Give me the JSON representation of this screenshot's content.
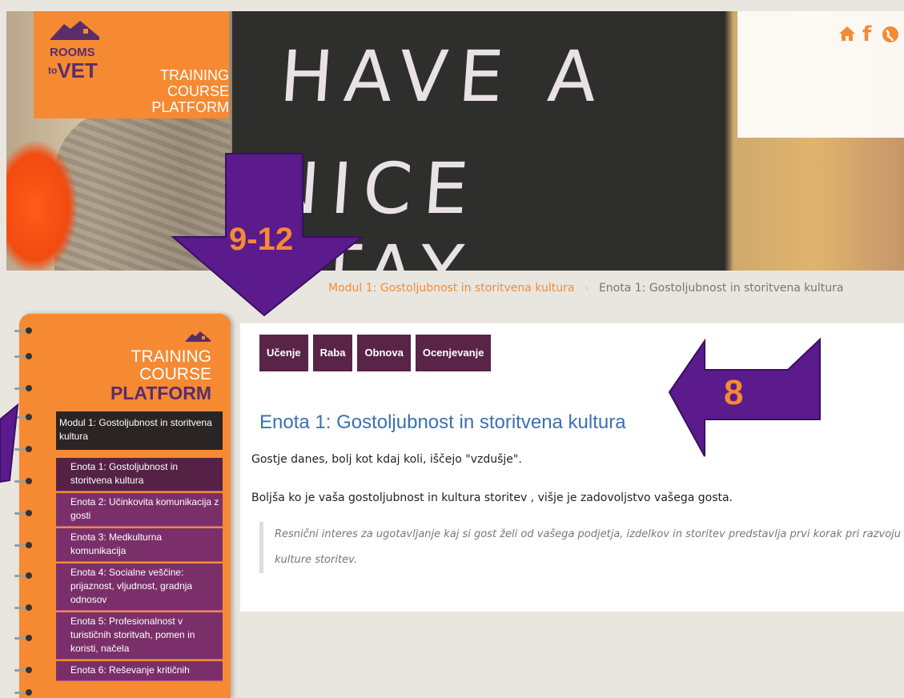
{
  "header": {
    "logo_rooms": "ROOMS",
    "logo_to": "to",
    "logo_vet": "VET",
    "logo_line1": "TRAINING COURSE",
    "logo_line2": "PLATFORM",
    "chalk_line1": "HAVE A",
    "chalk_line2": "NICE STAY",
    "icons": [
      "home-icon",
      "facebook-icon",
      "globe-icon"
    ],
    "icon_glyphs": {
      "home": "🏠",
      "facebook": "f",
      "globe": "◉"
    }
  },
  "breadcrumb": {
    "items": [
      "Modul 1: Gostoljubnost in storitvena kultura",
      "Enota 1: Gostoljubnost in storitvena kultura"
    ]
  },
  "sidebar": {
    "title1": "TRAINING COURSE",
    "title2": "PLATFORM",
    "module": "Modul 1: Gostoljubnost in storitvena kultura",
    "items": [
      {
        "label": "Enota 1: Gostoljubnost in storitvena kultura",
        "selected": true
      },
      {
        "label": "Enota 2: Učinkovita komunikacija z gosti"
      },
      {
        "label": "Enota 3: Medkulturna komunikacija"
      },
      {
        "label": "Enota 4: Socialne veščine: prijaznost, vljudnost, gradnja odnosov"
      },
      {
        "label": "Enota 5: Profesionalnost v turističnih storitvah, pomen in koristi, načela"
      },
      {
        "label": "Enota 6: Reševanje kritičnih"
      }
    ]
  },
  "main": {
    "tabs": [
      "Učenje",
      "Raba",
      "Obnova",
      "Ocenjevanje"
    ],
    "title": "Enota 1: Gostoljubnost in storitvena kultura",
    "para1": "Gostje danes, bolj kot kdaj koli, iščejo \"vzdušje\".",
    "para2": "Boljša ko je vaša gostoljubnost in kultura storitev , višje je zadovoljstvo vašega gosta.",
    "quote": "Resnični interes za ugotavljanje kaj si gost želi od vašega podjetja, izdelkov in storitev predstavlja prvi korak pri razvoju kulture storitev."
  },
  "annotations": {
    "label_down": "9-12",
    "label_left": "8",
    "arrow_color": "#5b1b8c",
    "label_color": "#f58a33"
  },
  "colors": {
    "orange": "#f58a33",
    "purple": "#5a2448",
    "title_blue": "#3a70b4"
  }
}
